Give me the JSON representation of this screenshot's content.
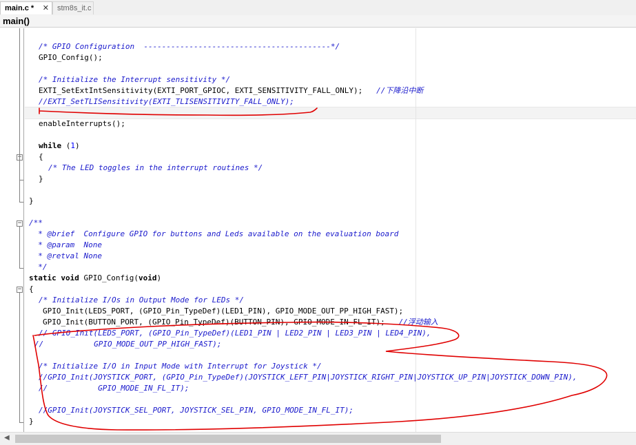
{
  "tabs": [
    {
      "label": "main.c *",
      "close": "✕",
      "active": true
    },
    {
      "label": "stm8s_it.c",
      "active": false
    }
  ],
  "function_bar": {
    "label": "main()"
  },
  "code": {
    "l1": "/* GPIO Configuration  -----------------------------------------*/",
    "l2": "GPIO_Config();",
    "l3": "/* Initialize the Interrupt sensitivity */",
    "l4a": "EXTI_SetExtIntSensitivity(EXTI_PORT_GPIOC, EXTI_SENSITIVITY_FALL_ONLY);   ",
    "l4b": "//下降沿中断",
    "l5": "//EXTI_SetTLISensitivity(EXTI_TLISENSITIVITY_FALL_ONLY);",
    "l7": "enableInterrupts();",
    "l8a": "while",
    "l8b": " (",
    "l8c": "1",
    "l8d": ")",
    "l9": "{",
    "l10": "/* The LED toggles in the interrupt routines */",
    "l11": "}",
    "l12": "}",
    "l13": "/**",
    "l14": "  * @brief  Configure GPIO for buttons and Leds available on the evaluation board",
    "l15": "  * @param  None",
    "l16": "  * @retval None",
    "l17": "  */",
    "l18a": "static",
    "l18b": " ",
    "l18c": "void",
    "l18d": " GPIO_Config(",
    "l18e": "void",
    "l18f": ")",
    "l19": "{",
    "l20": "/* Initialize I/Os in Output Mode for LEDs */",
    "l21": "GPIO_Init(LEDS_PORT, (GPIO_Pin_TypeDef)(LED1_PIN), GPIO_MODE_OUT_PP_HIGH_FAST);",
    "l22a": "GPIO_Init(BUTTON_PORT, (GPIO_Pin_TypeDef)(BUTTON_PIN), GPIO_MODE_IN_FL_IT);   ",
    "l22b": "//浮动输入",
    "l23": "// GPIO_Init(LEDS_PORT, (GPIO_Pin_TypeDef)(LED1_PIN | LED2_PIN | LED3_PIN | LED4_PIN),",
    "l24": "//           GPIO_MODE_OUT_PP_HIGH_FAST);",
    "l26": "/* Initialize I/O in Input Mode with Interrupt for Joystick */",
    "l27": "//GPIO_Init(JOYSTICK_PORT, (GPIO_Pin_TypeDef)(JOYSTICK_LEFT_PIN|JOYSTICK_RIGHT_PIN|JOYSTICK_UP_PIN|JOYSTICK_DOWN_PIN),",
    "l28": "//           GPIO_MODE_IN_FL_IT);",
    "l30": "//GPIO_Init(JOYSTICK_SEL_PORT, JOYSTICK_SEL_PIN, GPIO_MODE_IN_FL_IT);",
    "l31": "}"
  },
  "colors": {
    "comment": "#1a1acc",
    "annotation": "#e00000",
    "number": "#0000ff"
  },
  "icons": {
    "fold_open": "−",
    "scroll_left": "◀"
  }
}
